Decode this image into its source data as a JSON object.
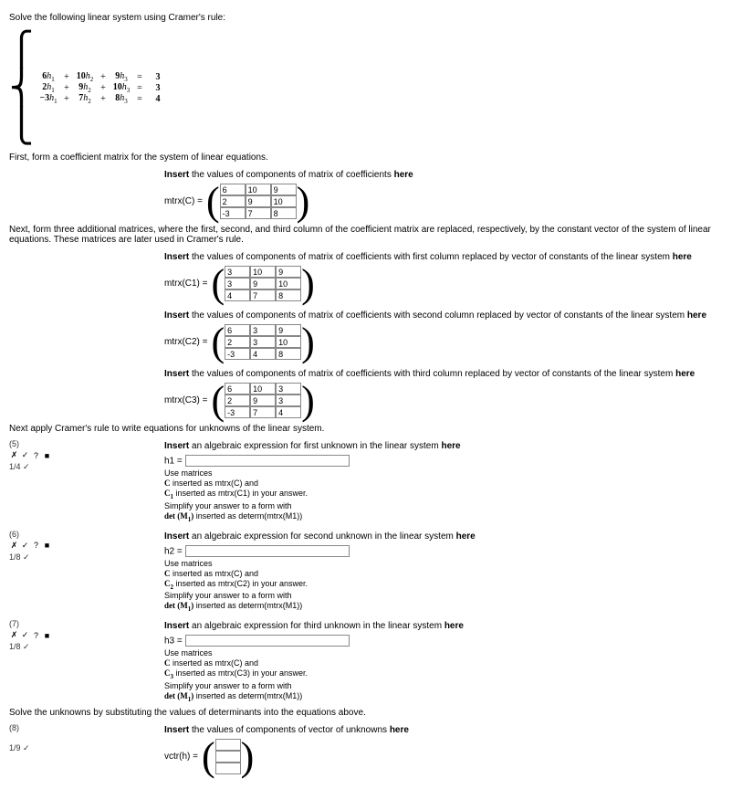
{
  "intro": "Solve the following linear system using Cramer's rule:",
  "system": {
    "rows": [
      {
        "a": "6",
        "h": "h",
        "s1": "1",
        "op1": "+",
        "b": "10",
        "h2": "h",
        "s2": "2",
        "op2": "+",
        "c": "9",
        "h3": "h",
        "s3": "3",
        "eq": "=",
        "r": "3"
      },
      {
        "a": "2",
        "h": "h",
        "s1": "1",
        "op1": "+",
        "b": "9",
        "h2": "h",
        "s2": "2",
        "op2": "+",
        "c": "10",
        "h3": "h",
        "s3": "3",
        "eq": "=",
        "r": "3"
      },
      {
        "a": "−3",
        "h": "h",
        "s1": "1",
        "op1": "+",
        "b": "7",
        "h2": "h",
        "s2": "2",
        "op2": "+",
        "c": "8",
        "h3": "h",
        "s3": "3",
        "eq": "=",
        "r": "4"
      }
    ]
  },
  "step1": "First, form a coefficient matrix for the system of linear equations.",
  "mC_prompt": {
    "pre": "Insert",
    "mid": " the values of components of matrix of coefficients ",
    "post": "here"
  },
  "mC_label": "mtrx(C) =",
  "mC": [
    [
      "6",
      "10",
      "9"
    ],
    [
      "2",
      "9",
      "10"
    ],
    [
      "-3",
      "7",
      "8"
    ]
  ],
  "step2": "Next, form three additional matrices, where the first, second, and third column of the coefficient matrix are replaced, respectively, by the constant vector of the system of linear equations. These matrices are later used in Cramer's rule.",
  "mC1_prompt": {
    "pre": "Insert",
    "mid": " the values of components of matrix of coefficients with first column replaced by vector of constants of the linear system ",
    "post": "here"
  },
  "mC1_label": "mtrx(C1) =",
  "mC1": [
    [
      "3",
      "10",
      "9"
    ],
    [
      "3",
      "9",
      "10"
    ],
    [
      "4",
      "7",
      "8"
    ]
  ],
  "mC2_prompt": {
    "pre": "Insert",
    "mid": " the values of components of matrix of coefficients with second column replaced by vector of constants of the linear system ",
    "post": "here"
  },
  "mC2_label": "mtrx(C2) =",
  "mC2": [
    [
      "6",
      "3",
      "9"
    ],
    [
      "2",
      "3",
      "10"
    ],
    [
      "-3",
      "4",
      "8"
    ]
  ],
  "mC3_prompt": {
    "pre": "Insert",
    "mid": " the values of components of matrix of coefficients with third column replaced by vector of constants of the linear system ",
    "post": "here"
  },
  "mC3_label": "mtrx(C3) =",
  "mC3": [
    [
      "6",
      "10",
      "3"
    ],
    [
      "2",
      "9",
      "3"
    ],
    [
      "-3",
      "7",
      "4"
    ]
  ],
  "step3": "Next apply Cramer's rule to write equations for unknowns of the linear system.",
  "q5": {
    "num": "(5)",
    "score": "1/4 ✓"
  },
  "h1_prompt": {
    "pre": "Insert",
    "mid": " an algebraic expression for first unknown in the linear system ",
    "post": "here"
  },
  "h1_label": "h1 =",
  "hints_block1": {
    "l1": "Use matrices",
    "l2a": "C",
    "l2b": " inserted as mtrx(C) and",
    "l3a": "C",
    "l3sub": "1",
    "l3b": " inserted as mtrx(C1) in your answer.",
    "l4": "Simplify your answer to a form with",
    "l5a": "det (M",
    "l5sub": "1",
    "l5b": ")",
    "l5c": " inserted as determ(mtrx(M1))"
  },
  "q6": {
    "num": "(6)",
    "score": "1/8 ✓"
  },
  "h2_prompt": {
    "pre": "Insert",
    "mid": " an algebraic expression for second unknown in the linear system ",
    "post": "here"
  },
  "h2_label": "h2 =",
  "hints_block2": {
    "l1": "Use matrices",
    "l2a": "C",
    "l2b": " inserted as mtrx(C) and",
    "l3a": "C",
    "l3sub": "2",
    "l3b": " inserted as mtrx(C2) in your answer.",
    "l4": "Simplify your answer to a form with",
    "l5a": "det (M",
    "l5sub": "1",
    "l5b": ")",
    "l5c": " inserted as determ(mtrx(M1))"
  },
  "q7": {
    "num": "(7)",
    "score": "1/8 ✓"
  },
  "h3_prompt": {
    "pre": "Insert",
    "mid": " an algebraic expression for third unknown in the linear system ",
    "post": "here"
  },
  "h3_label": "h3 =",
  "hints_block3": {
    "l1": "Use matrices",
    "l2a": "C",
    "l2b": " inserted as mtrx(C) and",
    "l3a": "C",
    "l3sub": "3",
    "l3b": " inserted as mtrx(C3) in your answer.",
    "l4": "Simplify your answer to a form with",
    "l5a": "det (M",
    "l5sub": "1",
    "l5b": ")",
    "l5c": " inserted as determ(mtrx(M1))"
  },
  "step4": "Solve the unknowns by substituting the values of determinants into the equations above.",
  "q8": {
    "num": "(8)",
    "score": "1/9 ✓"
  },
  "vh_prompt": {
    "pre": "Insert",
    "mid": " the values of components of vector of unknowns ",
    "post": "here"
  },
  "vh_label": "vctr(h) =",
  "vh": [
    "",
    "",
    ""
  ],
  "icons": {
    "x": "✗",
    "chk": "✓",
    "q": "?",
    "b": "■"
  }
}
